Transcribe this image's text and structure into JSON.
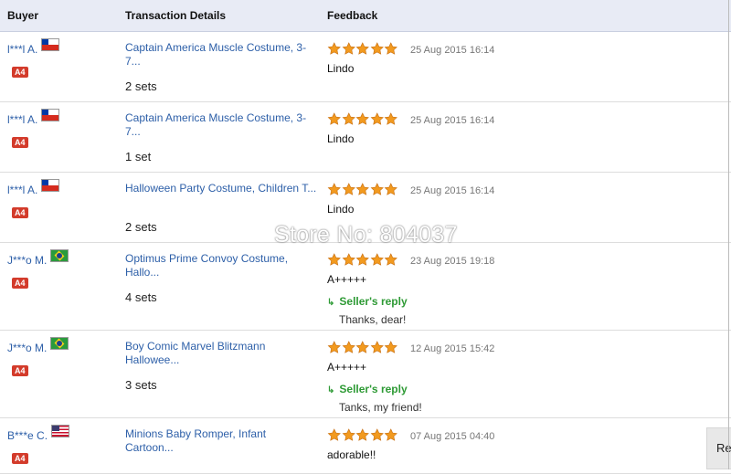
{
  "header": {
    "buyer": "Buyer",
    "details": "Transaction Details",
    "feedback": "Feedback"
  },
  "rows": [
    {
      "buyer": "l***l A.",
      "flag": "CL",
      "badge": "A4",
      "product": "Captain America Muscle Costume, 3-7...",
      "qty": "2 sets",
      "rating": 5,
      "date": "25 Aug 2015 16:14",
      "feedback": "Lindo",
      "reply_label": "",
      "reply": ""
    },
    {
      "buyer": "l***l A.",
      "flag": "CL",
      "badge": "A4",
      "product": "Captain America Muscle Costume, 3-7...",
      "qty": "1 set",
      "rating": 5,
      "date": "25 Aug 2015 16:14",
      "feedback": "Lindo",
      "reply_label": "",
      "reply": ""
    },
    {
      "buyer": "l***l A.",
      "flag": "CL",
      "badge": "A4",
      "product": "Halloween Party Costume, Children T...",
      "qty": "2 sets",
      "rating": 5,
      "date": "25 Aug 2015 16:14",
      "feedback": "Lindo",
      "reply_label": "",
      "reply": ""
    },
    {
      "buyer": "J***o M.",
      "flag": "BR",
      "badge": "A4",
      "product": "Optimus Prime Convoy Costume, Hallo...",
      "qty": "4 sets",
      "rating": 5,
      "date": "23 Aug 2015 19:18",
      "feedback": "A+++++",
      "reply_label": "Seller's reply",
      "reply": "Thanks, dear!"
    },
    {
      "buyer": "J***o M.",
      "flag": "BR",
      "badge": "A4",
      "product": "Boy Comic Marvel Blitzmann Hallowee...",
      "qty": "3 sets",
      "rating": 5,
      "date": "12 Aug 2015 15:42",
      "feedback": "A+++++",
      "reply_label": "Seller's reply",
      "reply": "Tanks, my friend!"
    },
    {
      "buyer": "B***e C.",
      "flag": "US",
      "badge": "A4",
      "product": "Minions Baby Romper, Infant Cartoon...",
      "qty": "",
      "rating": 5,
      "date": "07 Aug 2015 04:40",
      "feedback": "adorable!!",
      "reply_label": "",
      "reply": ""
    }
  ],
  "watermark": "Store No: 804037",
  "side_button": "Re",
  "colors": {
    "link": "#2d5fa8",
    "reply": "#2e9a35",
    "badge": "#d33b2b",
    "star": "#f29a1f",
    "header_bg": "#e8ebf5"
  }
}
